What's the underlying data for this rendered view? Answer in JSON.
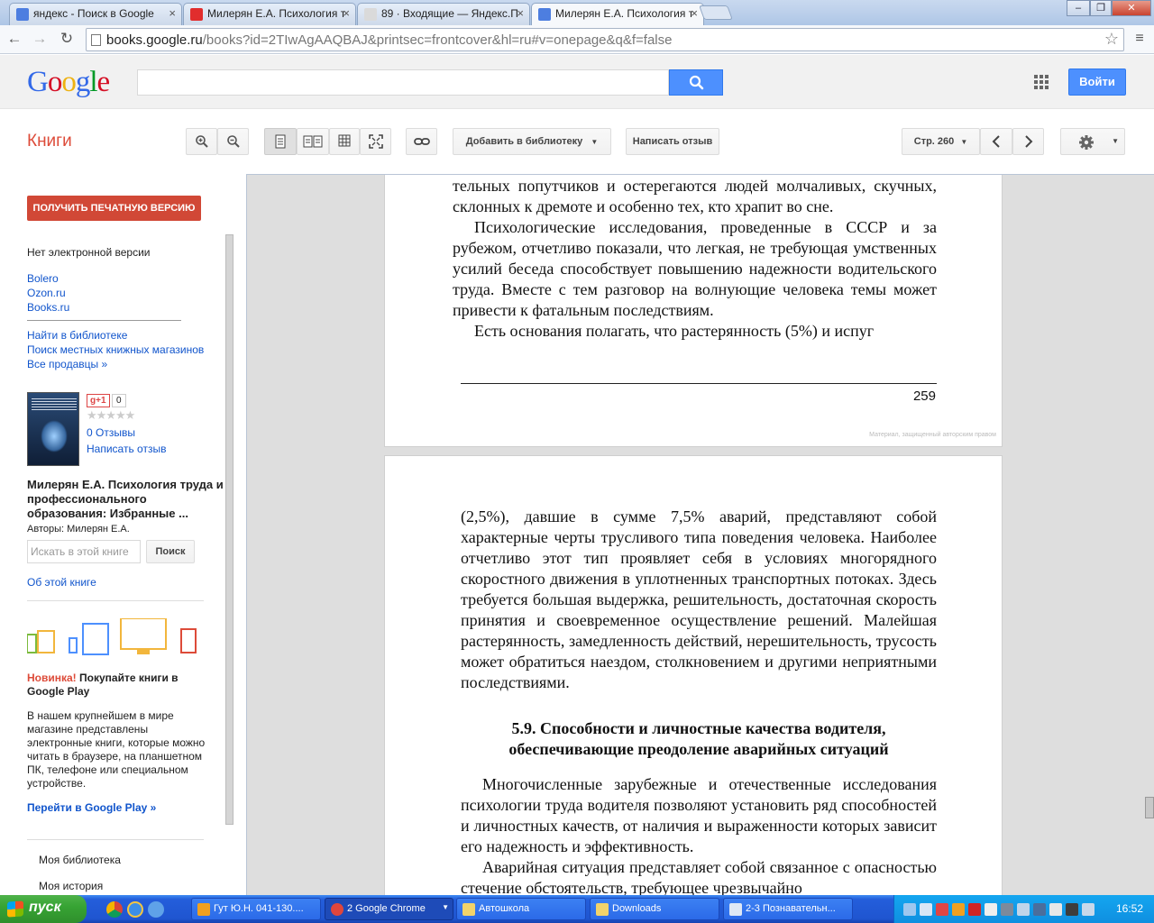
{
  "browser": {
    "tabs": [
      {
        "title": "яндекс - Поиск в Google",
        "favicon_color": "#4d7ee0"
      },
      {
        "title": "Милерян Е.А. Психология т",
        "favicon_color": "#e12d2d"
      },
      {
        "title": "89 · Входящие — Яндекс.П",
        "favicon_color": "#dadada"
      },
      {
        "title": "Милерян Е.А. Психология т",
        "favicon_color": "#4d7ee0"
      }
    ],
    "active_tab": 3,
    "url_host": "books.google.ru",
    "url_path": "/books?id=2TIwAgAAQBAJ&printsec=frontcover&hl=ru#v=onepage&q&f=false",
    "window_buttons": {
      "minimize": "–",
      "maximize": "❐",
      "close": "✕"
    }
  },
  "google_bar": {
    "logo": "Google",
    "search_value": "",
    "signin_label": "Войти"
  },
  "books_toolbar": {
    "section_title": "Книги",
    "add_to_library_label": "Добавить в библиотеку",
    "write_review_label": "Написать отзыв",
    "page_label": "Стр. 260"
  },
  "sidebar": {
    "get_print_label": "ПОЛУЧИТЬ ПЕЧАТНУЮ ВЕРСИЮ",
    "no_ebook": "Нет электронной версии",
    "sellers": [
      "Bolero",
      "Ozon.ru",
      "Books.ru"
    ],
    "links": [
      "Найти в библиотеке",
      "Поиск местных книжных магазинов",
      "Все продавцы »"
    ],
    "gplus_label": "g+1",
    "gplus_count": "0",
    "rating_stars": "★★★★★",
    "reviews_link": "0 Отзывы",
    "write_review_link": "Написать отзыв",
    "book_title": "Милерян Е.А. Психология труда и профессионального образования: Избранные ...",
    "authors": "Авторы: Милерян Е.А.",
    "search_in_book_placeholder": "Искать в этой книге",
    "search_button": "Поиск",
    "about_link": "Об этой книге",
    "promo_new": "Новинка!",
    "promo_text": " Покупайте книги в Google Play",
    "promo_description": "В нашем крупнейшем в мире магазине представлены электронные книги, которые можно читать в браузере, на планшетном ПК, телефоне или специальном устройстве.",
    "play_link": "Перейти в Google Play »",
    "my_library": "Моя библиотека",
    "my_history": "Моя история"
  },
  "viewer": {
    "page1_paragraphs": [
      {
        "indent": false,
        "text": "тельных попутчиков и остерегаются людей молчаливых, скучных, склонных к дремоте и особенно тех, кто храпит во сне."
      },
      {
        "indent": true,
        "text": "Психологические исследования, проведенные в СССР и за рубежом, отчетливо показали, что легкая, не требующая умственных усилий беседа способствует повышению надежности водительского труда. Вместе с тем разговор на волнующие человека темы может привести к фатальным последствиям."
      },
      {
        "indent": true,
        "text": "Есть основания полагать, что растерянность (5%) и испуг"
      }
    ],
    "page1_number": "259",
    "page1_watermark": "Материал, защищенный авторским правом",
    "page2_para1": "(2,5%), давшие в сумме 7,5% аварий, представляют собой характерные черты трусливого типа поведения человека. Наиболее отчетливо этот тип проявляет себя в условиях многорядного скоростного движения в уплотненных транспортных потоках. Здесь требуется большая выдержка, решительность, достаточная скорость принятия и своевременное осуществление решений. Малейшая растерянность, замедленность действий, нерешительность, трусость может обратиться наездом, столкновением и другими неприятными последствиями.",
    "heading": "5.9.      Способности и личностные качества водителя, обеспечивающие преодоление аварийных ситуаций",
    "page2_para2": "Многочисленные зарубежные и отечественные исследования психологии труда водителя позволяют установить ряд способностей и личностных качеств, от наличия и выраженности которых зависит его надежность и эффективность.",
    "page2_para3": "Аварийная ситуация представляет собой связанное с опасностью стечение обстоятельств, требующее чрезвычайно"
  },
  "taskbar": {
    "start_label": "пуск",
    "tasks": [
      {
        "label": "Гут Ю.Н. 041-130....",
        "icon_color": "#f0a020",
        "active": false
      },
      {
        "label": "2 Google Chrome",
        "icon_color": "#e0463c",
        "active": true
      },
      {
        "label": "Автошкола",
        "icon_color": "#f2d36b",
        "active": false
      },
      {
        "label": "Downloads",
        "icon_color": "#f2d36b",
        "active": false
      },
      {
        "label": "2-3 Познавательн...",
        "icon_color": "#dfe8f5",
        "active": false
      }
    ],
    "clock": "16:52"
  }
}
